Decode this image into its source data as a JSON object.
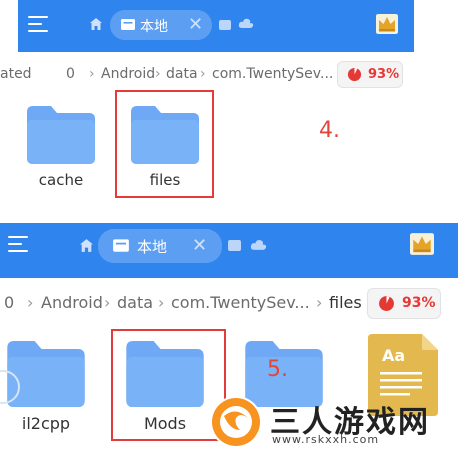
{
  "panel1": {
    "tab_label": "本地",
    "breadcrumb": [
      "ated",
      "0",
      "Android",
      "data",
      "com.TwentySev..."
    ],
    "storage_percent": "93%",
    "folders": [
      {
        "name": "cache"
      },
      {
        "name": "files"
      }
    ],
    "step_label": "4."
  },
  "panel2": {
    "tab_label": "本地",
    "breadcrumb": [
      "0",
      "Android",
      "data",
      "com.TwentySev...",
      "files"
    ],
    "storage_percent": "93%",
    "folders": [
      {
        "name": "il2cpp"
      },
      {
        "name": "Mods"
      }
    ],
    "doc_icon_text": "Aa",
    "step_label": "5."
  },
  "watermark": {
    "name": "三人游戏网",
    "url": "www.rskxxh.com"
  },
  "colors": {
    "bar_blue": "#2f84ee",
    "folder_blue": "#6fa8f5",
    "highlight_red": "#e23b3b",
    "storage_red": "#e53935"
  },
  "icons": [
    "menu-icon",
    "home-icon",
    "folder-tab-icon",
    "close-icon",
    "chat-icon",
    "cloud-icon",
    "crown-icon",
    "pie-chart-icon",
    "document-icon"
  ]
}
